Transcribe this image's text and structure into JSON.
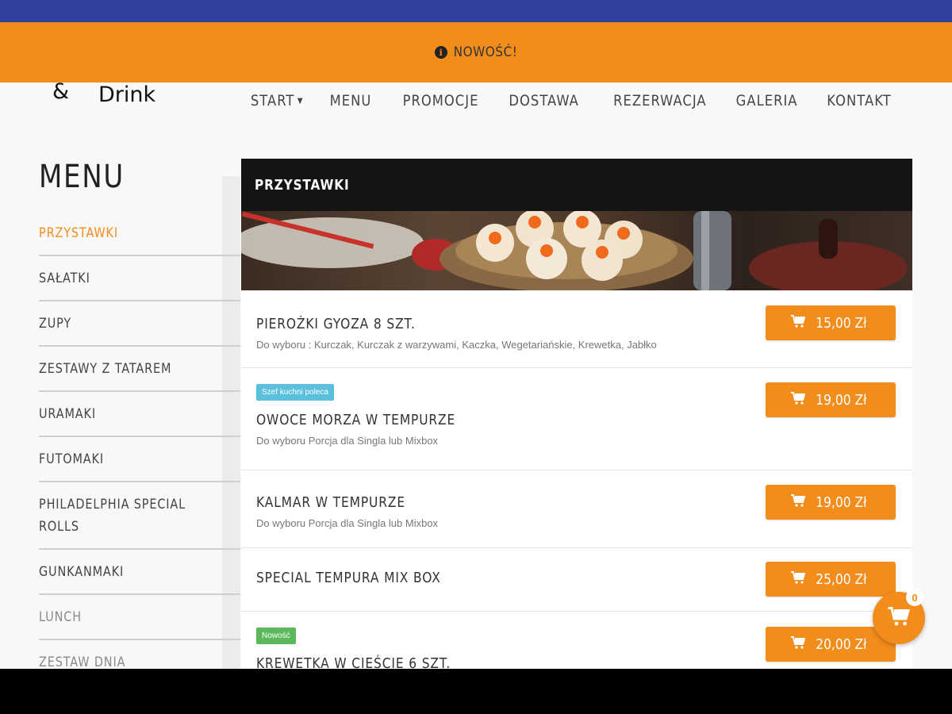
{
  "announcement": {
    "text": "NOWOŚĆ!",
    "icon": "info-icon"
  },
  "logo": {
    "amp": "&",
    "word": "Drink"
  },
  "nav": [
    {
      "label": "START",
      "has_dropdown": true
    },
    {
      "label": "MENU"
    },
    {
      "label": "PROMOCJE"
    },
    {
      "label": "DOSTAWA"
    },
    {
      "label": "REZERWACJA"
    },
    {
      "label": "GALERIA"
    },
    {
      "label": "KONTAKT"
    }
  ],
  "sidebar": {
    "title": "MENU",
    "items": [
      {
        "label": "PRZYSTAWKI"
      },
      {
        "label": "SAŁATKI"
      },
      {
        "label": "ZUPY"
      },
      {
        "label": "ZESTAWY Z TATAREM"
      },
      {
        "label": "URAMAKI"
      },
      {
        "label": "FUTOMAKI"
      },
      {
        "label": "PHILADELPHIA SPECIAL ROLLS"
      },
      {
        "label": "GUNKANMAKI"
      },
      {
        "label": "LUNCH"
      },
      {
        "label": "ZESTAW DNIA"
      }
    ]
  },
  "section": {
    "title": "PRZYSTAWKI",
    "items": [
      {
        "name": "PIEROŻKI GYOZA 8 SZT.",
        "desc": "Do wyboru : Kurczak, Kurczak z warzywami, Kaczka, Wegetariańskie, Krewetka, Jabłko",
        "price": "15,00 Zł",
        "badge": ""
      },
      {
        "name": "OWOCE MORZA W TEMPURZE",
        "desc": "Do wyboru Porcja dla Singla lub Mixbox",
        "price": "19,00 Zł",
        "badge": "Szef kuchni poleca"
      },
      {
        "name": "KALMAR W TEMPURZE",
        "desc": "Do wyboru Porcja dla Singla lub Mixbox",
        "price": "19,00 Zł",
        "badge": ""
      },
      {
        "name": "SPECIAL TEMPURA MIX BOX",
        "desc": "",
        "price": "25,00 Zł",
        "badge": ""
      },
      {
        "name": "KREWETKA W CIEŚCIE 6 SZT.",
        "desc": "",
        "price": "20,00 Zł",
        "badge": "Nowość"
      }
    ]
  },
  "cart": {
    "count": "0"
  },
  "colors": {
    "accent": "#f28c1b",
    "top_bar": "#33409c",
    "header_dark": "#141414",
    "badge_blue": "#5bc0de",
    "badge_green": "#5cb85c"
  }
}
